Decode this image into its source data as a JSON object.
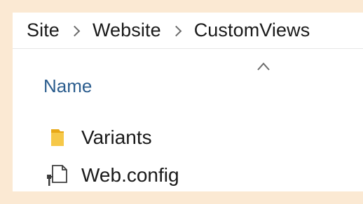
{
  "breadcrumb": {
    "items": [
      "Site",
      "Website",
      "CustomViews"
    ]
  },
  "columns": {
    "name_header": "Name",
    "sort_icon": "chevron-up-icon"
  },
  "files": [
    {
      "name": "Variants",
      "icon": "folder-icon"
    },
    {
      "name": "Web.config",
      "icon": "config-file-icon"
    }
  ],
  "colors": {
    "background": "#fbe9d3",
    "pane": "#ffffff",
    "header_text": "#2b5d8e",
    "folder": "#f4c542"
  }
}
